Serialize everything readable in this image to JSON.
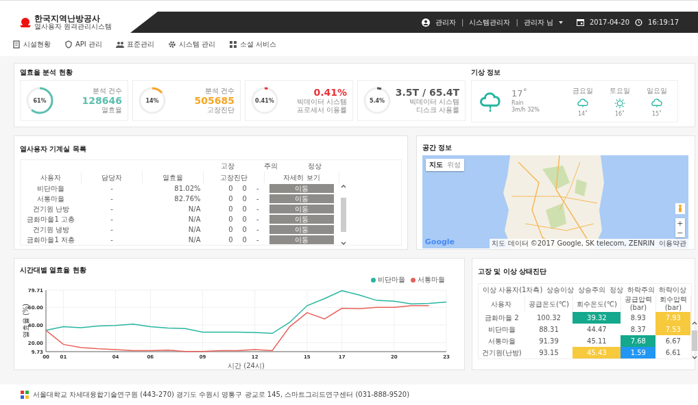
{
  "header": {
    "logo_title": "한국지역난방공사",
    "logo_subtitle": "열사용자 원격관리시스템",
    "user_role": "관리자",
    "separators": [
      "|",
      "|"
    ],
    "user_group": "시스템관리자",
    "user_menu": "관리자 님",
    "date": "2017-04-20",
    "time": "16:19:17"
  },
  "nav": [
    "시설현황",
    "API 관리",
    "표준관리",
    "시스템 관리",
    "소셜 서비스"
  ],
  "efficiency": {
    "title": "열효율 분석 현황",
    "cards": [
      {
        "level": 0.61,
        "gauge_label": "61%",
        "color": "#5bbfae",
        "above": "분석 건수",
        "value": "128646",
        "below": [
          "열효율"
        ]
      },
      {
        "level": 0.14,
        "gauge_label": "14%",
        "color": "#f5a623",
        "above": "분석 건수",
        "value": "505685",
        "below": [
          "고장진단"
        ]
      },
      {
        "level": 0.0041,
        "gauge_label": "0.41%",
        "color": "#e8343a",
        "value": "0.41%",
        "below": [
          "빅데이터 시스템",
          "프로세서 이용률"
        ]
      },
      {
        "level": 0.054,
        "gauge_label": "5.4%",
        "color": "#555555",
        "value": "3.5T / 65.4T",
        "below": [
          "빅데이터 시스템",
          "디스크 사용률"
        ]
      }
    ]
  },
  "weather": {
    "title": "기상 정보",
    "current": {
      "temp": "17˚",
      "condition": "Rain",
      "detail": "3m/h 32%"
    },
    "forecast": [
      {
        "day": "금요일",
        "kind": "cloud",
        "temp": "14˚"
      },
      {
        "day": "토요일",
        "kind": "sun",
        "temp": "16˚"
      },
      {
        "day": "일요일",
        "kind": "cloud",
        "temp": "15˚"
      }
    ]
  },
  "machines": {
    "title": "열사용자 기계실 목록",
    "legend": [
      "고장",
      "주의",
      "정상"
    ],
    "columns": [
      "사용자",
      "담당자",
      "열효율",
      "고장진단",
      "자세히 보기"
    ],
    "rows": [
      {
        "user": "비단마을",
        "manager": "-",
        "efficiency": "81.02%",
        "fault": "0",
        "warning": "0",
        "normal": "-",
        "action": "이동"
      },
      {
        "user": "서통마을",
        "manager": "-",
        "efficiency": "82.76%",
        "fault": "0",
        "warning": "0",
        "normal": "-",
        "action": "이동"
      },
      {
        "user": "건기원 난방",
        "manager": "-",
        "efficiency": "N/A",
        "fault": "0",
        "warning": "0",
        "normal": "-",
        "action": "이동"
      },
      {
        "user": "금화마을1 고층",
        "manager": "-",
        "efficiency": "N/A",
        "fault": "0",
        "warning": "0",
        "normal": "-",
        "action": "이동"
      },
      {
        "user": "건기원 냉방",
        "manager": "-",
        "efficiency": "N/A",
        "fault": "0",
        "warning": "0",
        "normal": "-",
        "action": "이동"
      },
      {
        "user": "금화마을1 저층",
        "manager": "-",
        "efficiency": "N/A",
        "fault": "0",
        "warning": "0",
        "normal": "-",
        "action": "이동"
      }
    ]
  },
  "map": {
    "title": "공간 정보",
    "map_types": [
      {
        "label": "지도",
        "selected": true
      },
      {
        "label": "위성",
        "selected": false
      }
    ],
    "brand": "Google",
    "attribution": "지도 데이터 ©2017 Google, SK telecom, ZENRIN",
    "terms": "이용약관",
    "zoom_in": "+",
    "zoom_out": "−"
  },
  "chart": {
    "title": "시간대별 열효율 현황",
    "chart_data": {
      "type": "line",
      "xlabel": "시간 (24시)",
      "ylabel": "열효율 (%)",
      "x": [
        0,
        1,
        2,
        3,
        4,
        5,
        6,
        7,
        8,
        9,
        10,
        11,
        12,
        13,
        14,
        15,
        16,
        17,
        18,
        19,
        20,
        21,
        22,
        23
      ],
      "xlim": [
        0,
        23
      ],
      "ylim": [
        9.73,
        79.71
      ],
      "grid": true,
      "yticks": [
        9.73,
        {
          "value": 20,
          "label": "20.00"
        },
        {
          "value": 40,
          "label": "40.00"
        },
        {
          "value": 60,
          "label": "60.00"
        },
        79.71
      ],
      "xticks": [
        {
          "value": 0,
          "label": "00"
        },
        {
          "value": 1,
          "label": "01"
        },
        {
          "value": 4,
          "label": "04"
        },
        {
          "value": 6,
          "label": "06"
        },
        {
          "value": 9,
          "label": "09"
        },
        {
          "value": 12,
          "label": "12"
        },
        {
          "value": 15,
          "label": "15"
        },
        {
          "value": 17,
          "label": "17"
        },
        {
          "value": 20,
          "label": "20"
        },
        {
          "value": 23,
          "label": "23"
        }
      ],
      "series": [
        {
          "name": "비단마을",
          "color": "#26b5a0",
          "values": [
            34,
            38,
            37,
            39,
            39.5,
            41,
            38,
            36.5,
            36,
            32,
            32,
            32,
            31.5,
            30.5,
            43,
            62,
            70,
            79,
            74,
            68,
            67,
            64,
            64.5,
            66
          ]
        },
        {
          "name": "서통마을",
          "color": "#e8605a",
          "values": [
            34,
            18,
            14.5,
            13,
            12,
            11,
            11,
            11.5,
            10,
            9.9,
            11,
            11,
            12,
            11,
            38,
            54,
            47,
            59,
            58.5,
            60,
            60,
            62,
            62,
            null
          ]
        }
      ]
    }
  },
  "diagnosis": {
    "title": "고장 및 이상 상태진단",
    "group_label": "이상 사용자(1차측)",
    "legend": [
      "상승이상",
      "상승주의",
      "정상",
      "하락주의",
      "하락이상"
    ],
    "columns": [
      "사용자",
      "공급온도(℃)",
      "회수온도(℃)",
      "공급압력(bar)",
      "회수압력(bar)"
    ],
    "rows": [
      {
        "cells": [
          {
            "text": "금화마을 2"
          },
          {
            "text": "100.32"
          },
          {
            "text": "39.32",
            "color": "#14a88c"
          },
          {
            "text": "8.93"
          },
          {
            "text": "7.93",
            "color": "#f7c93c"
          }
        ]
      },
      {
        "cells": [
          {
            "text": "비단마을"
          },
          {
            "text": "88.31"
          },
          {
            "text": "44.47"
          },
          {
            "text": "8.37"
          },
          {
            "text": "7.53",
            "color": "#f7c93c"
          }
        ]
      },
      {
        "cells": [
          {
            "text": "서통마을"
          },
          {
            "text": "91.39"
          },
          {
            "text": "45.11"
          },
          {
            "text": "7.68",
            "color": "#14a88c"
          },
          {
            "text": "6.67"
          }
        ]
      },
      {
        "cells": [
          {
            "text": "건기원(난방)"
          },
          {
            "text": "93.15"
          },
          {
            "text": "45.43",
            "color": "#f7c93c"
          },
          {
            "text": "1.59",
            "color": "#2196f3"
          },
          {
            "text": "6.61"
          }
        ]
      }
    ]
  },
  "footer": {
    "text": "서울대학교 차세대융합기술연구원 (443-270) 경기도 수원시 영통구 광교로 145, 스마트그리드연구센터 (031-888-9520)"
  }
}
